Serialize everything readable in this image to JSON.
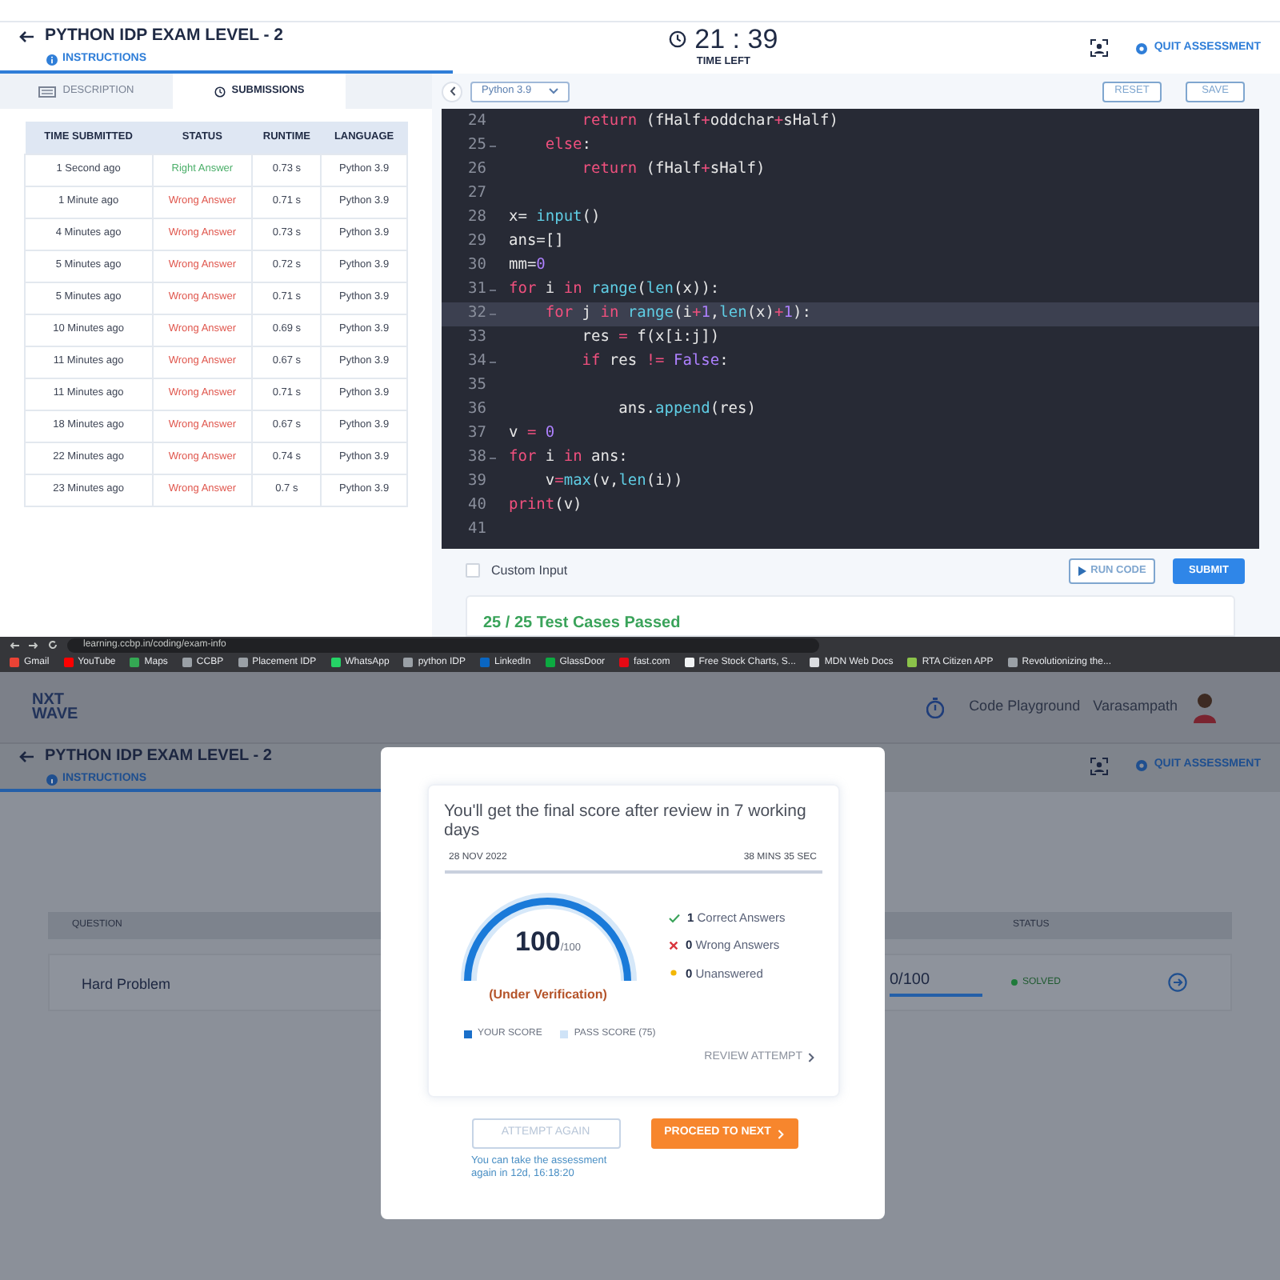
{
  "exam_top": {
    "title": "PYTHON IDP EXAM LEVEL - 2",
    "instructions": "INSTRUCTIONS",
    "timer": "21 : 39",
    "timer_label": "TIME LEFT",
    "quit": "QUIT ASSESSMENT"
  },
  "panel_tabs": [
    {
      "label": "DESCRIPTION",
      "selected": false
    },
    {
      "label": "SUBMISSIONS",
      "selected": true
    }
  ],
  "submissions": {
    "columns": [
      "TIME SUBMITTED",
      "STATUS",
      "RUNTIME",
      "LANGUAGE"
    ],
    "rows": [
      {
        "time": "1 Second ago",
        "status": "Right Answer",
        "correct": true,
        "runtime": "0.73 s",
        "language": "Python 3.9"
      },
      {
        "time": "1 Minute ago",
        "status": "Wrong Answer",
        "correct": false,
        "runtime": "0.71 s",
        "language": "Python 3.9"
      },
      {
        "time": "4 Minutes ago",
        "status": "Wrong Answer",
        "correct": false,
        "runtime": "0.73 s",
        "language": "Python 3.9"
      },
      {
        "time": "5 Minutes ago",
        "status": "Wrong Answer",
        "correct": false,
        "runtime": "0.72 s",
        "language": "Python 3.9"
      },
      {
        "time": "5 Minutes ago",
        "status": "Wrong Answer",
        "correct": false,
        "runtime": "0.71 s",
        "language": "Python 3.9"
      },
      {
        "time": "10 Minutes ago",
        "status": "Wrong Answer",
        "correct": false,
        "runtime": "0.69 s",
        "language": "Python 3.9"
      },
      {
        "time": "11 Minutes ago",
        "status": "Wrong Answer",
        "correct": false,
        "runtime": "0.67 s",
        "language": "Python 3.9"
      },
      {
        "time": "11 Minutes ago",
        "status": "Wrong Answer",
        "correct": false,
        "runtime": "0.71 s",
        "language": "Python 3.9"
      },
      {
        "time": "18 Minutes ago",
        "status": "Wrong Answer",
        "correct": false,
        "runtime": "0.67 s",
        "language": "Python 3.9"
      },
      {
        "time": "22 Minutes ago",
        "status": "Wrong Answer",
        "correct": false,
        "runtime": "0.74 s",
        "language": "Python 3.9"
      },
      {
        "time": "23 Minutes ago",
        "status": "Wrong Answer",
        "correct": false,
        "runtime": "0.7 s",
        "language": "Python 3.9"
      }
    ]
  },
  "editor": {
    "language": "Python 3.9",
    "reset": "RESET",
    "save": "SAVE",
    "lines": [
      {
        "number": "24",
        "fold": false,
        "active": false,
        "tokens": [
          {
            "t": "        return",
            "color": "#f0507e"
          },
          {
            "t": " (fHalf",
            "color": "#e6e6e6"
          },
          {
            "t": "+",
            "color": "#f0507f"
          },
          {
            "t": "oddchar",
            "color": "#e6e6e6"
          },
          {
            "t": "+",
            "color": "#f0507f"
          },
          {
            "t": "sHalf)",
            "color": "#e6e6e6"
          }
        ]
      },
      {
        "number": "25",
        "fold": true,
        "active": false,
        "tokens": [
          {
            "t": "    else",
            "color": "#f0507e"
          },
          {
            "t": ":",
            "color": "#e6e6e6"
          }
        ]
      },
      {
        "number": "26",
        "fold": false,
        "active": false,
        "tokens": [
          {
            "t": "        return",
            "color": "#f0507e"
          },
          {
            "t": " (fHalf",
            "color": "#e6e6e6"
          },
          {
            "t": "+",
            "color": "#f0507f"
          },
          {
            "t": "sHalf)",
            "color": "#e6e6e6"
          }
        ]
      },
      {
        "number": "27",
        "fold": false,
        "active": false
      },
      {
        "number": "28",
        "fold": false,
        "active": false,
        "tokens": [
          {
            "t": "x= ",
            "color": "#e6e6e6"
          },
          {
            "t": "input",
            "color": "#5fcde4"
          },
          {
            "t": "()",
            "color": "#e6e6e6"
          }
        ]
      },
      {
        "number": "29",
        "fold": false,
        "active": false,
        "tokens": [
          {
            "t": "ans=[]",
            "color": "#e6e6e6"
          }
        ]
      },
      {
        "number": "30",
        "fold": false,
        "active": false,
        "tokens": [
          {
            "t": "mm=",
            "color": "#e6e6e6"
          },
          {
            "t": "0",
            "color": "#ae81ff"
          }
        ]
      },
      {
        "number": "31",
        "fold": true,
        "active": false,
        "tokens": [
          {
            "t": "for",
            "color": "#f0507e"
          },
          {
            "t": " i ",
            "color": "#e6e6e6"
          },
          {
            "t": "in",
            "color": "#f0507e"
          },
          {
            "t": " range",
            "color": "#5fcde4"
          },
          {
            "t": "(",
            "color": "#e6e6e6"
          },
          {
            "t": "len",
            "color": "#5fcde4"
          },
          {
            "t": "(x)):",
            "color": "#e6e6e6"
          }
        ]
      },
      {
        "number": "32",
        "fold": true,
        "active": true,
        "tokens": [
          {
            "t": "    for",
            "color": "#f0507e"
          },
          {
            "t": " j ",
            "color": "#e6e6e6"
          },
          {
            "t": "in",
            "color": "#f0507e"
          },
          {
            "t": " range",
            "color": "#5fcde4"
          },
          {
            "t": "(i",
            "color": "#e6e6e6"
          },
          {
            "t": "+",
            "color": "#f0507f"
          },
          {
            "t": "1",
            "color": "#ae81ff"
          },
          {
            "t": ",",
            "color": "#e6e6e6"
          },
          {
            "t": "len",
            "color": "#5fcde4"
          },
          {
            "t": "(x)",
            "color": "#e6e6e6"
          },
          {
            "t": "+",
            "color": "#f0507f"
          },
          {
            "t": "1",
            "color": "#ae81ff"
          },
          {
            "t": "):",
            "color": "#e6e6e6"
          }
        ]
      },
      {
        "number": "33",
        "fold": false,
        "active": false,
        "tokens": [
          {
            "t": "        res ",
            "color": "#e6e6e6"
          },
          {
            "t": "=",
            "color": "#f0507f"
          },
          {
            "t": " f(x[i:j])",
            "color": "#e6e6e6"
          }
        ]
      },
      {
        "number": "34",
        "fold": true,
        "active": false,
        "tokens": [
          {
            "t": "        if",
            "color": "#f0507e"
          },
          {
            "t": " res ",
            "color": "#e6e6e6"
          },
          {
            "t": "!=",
            "color": "#f0507f"
          },
          {
            "t": " False",
            "color": "#ae81ff"
          },
          {
            "t": ":",
            "color": "#e6e6e6"
          }
        ]
      },
      {
        "number": "35",
        "fold": false,
        "active": false
      },
      {
        "number": "36",
        "fold": false,
        "active": false,
        "tokens": [
          {
            "t": "            ans.",
            "color": "#e6e6e6"
          },
          {
            "t": "append",
            "color": "#5fcde4"
          },
          {
            "t": "(res)",
            "color": "#e6e6e6"
          }
        ]
      },
      {
        "number": "37",
        "fold": false,
        "active": false,
        "tokens": [
          {
            "t": "v ",
            "color": "#e6e6e6"
          },
          {
            "t": "=",
            "color": "#f0507f"
          },
          {
            "t": " 0",
            "color": "#ae81ff"
          }
        ]
      },
      {
        "number": "38",
        "fold": true,
        "active": false,
        "tokens": [
          {
            "t": "for",
            "color": "#f0507e"
          },
          {
            "t": " i ",
            "color": "#e6e6e6"
          },
          {
            "t": "in",
            "color": "#f0507e"
          },
          {
            "t": " ans:",
            "color": "#e6e6e6"
          }
        ]
      },
      {
        "number": "39",
        "fold": false,
        "active": false,
        "tokens": [
          {
            "t": "    v",
            "color": "#e6e6e6"
          },
          {
            "t": "=",
            "color": "#f0507f"
          },
          {
            "t": "max",
            "color": "#5fcde4"
          },
          {
            "t": "(v,",
            "color": "#e6e6e6"
          },
          {
            "t": "len",
            "color": "#5fcde4"
          },
          {
            "t": "(i))",
            "color": "#e6e6e6"
          }
        ]
      },
      {
        "number": "40",
        "fold": false,
        "active": false,
        "tokens": [
          {
            "t": "print",
            "color": "#f0507e"
          },
          {
            "t": "(v)",
            "color": "#e6e6e6"
          }
        ]
      },
      {
        "number": "41",
        "fold": false,
        "active": false
      }
    ],
    "custom_input": {
      "label": "Custom Input",
      "checked": false
    },
    "run": "RUN CODE",
    "submit": "SUBMIT",
    "result": "25 / 25 Test Cases Passed"
  },
  "browser": {
    "url": "learning.ccbp.in/coding/exam-info",
    "bookmarks": [
      {
        "label": "Gmail",
        "color": "#ea4335"
      },
      {
        "label": "YouTube",
        "color": "#ff0000"
      },
      {
        "label": "Maps",
        "color": "#34a853"
      },
      {
        "label": "CCBP",
        "color": "#9aa0a6"
      },
      {
        "label": "Placement IDP",
        "color": "#9aa0a6"
      },
      {
        "label": "WhatsApp",
        "color": "#25d366"
      },
      {
        "label": "python IDP",
        "color": "#9aa0a6"
      },
      {
        "label": "LinkedIn",
        "color": "#0a66c2"
      },
      {
        "label": "GlassDoor",
        "color": "#0caa41"
      },
      {
        "label": "fast.com",
        "color": "#e50914"
      },
      {
        "label": "Free Stock Charts, S...",
        "color": "#f1f3f4"
      },
      {
        "label": "MDN Web Docs",
        "color": "#dadce0"
      },
      {
        "label": "RTA Citizen APP",
        "color": "#8bc34a"
      },
      {
        "label": "Revolutionizing the...",
        "color": "#9aa0a6"
      }
    ]
  },
  "app_header": {
    "logo_top": "NXT",
    "logo_bottom": "WAVE",
    "playground": "Code Playground",
    "user": "Varasampath"
  },
  "exam_bottom": {
    "title": "PYTHON IDP EXAM LEVEL - 2",
    "instructions": "INSTRUCTIONS",
    "quit": "QUIT ASSESSMENT"
  },
  "questions": {
    "columns": [
      "QUESTION",
      "STATUS"
    ],
    "rows": [
      {
        "question": "Hard Problem",
        "score": "0/100",
        "status": "SOLVED"
      }
    ]
  },
  "result_modal": {
    "message": "You'll get the final score after review in 7 working days",
    "date": "28 NOV 2022",
    "duration": "38 MINS 35 SEC",
    "score": "100",
    "score_total": "/100",
    "level": 1,
    "verification": "(Under Verification)",
    "stats": [
      {
        "kind": "correct",
        "count": "1",
        "label": "Correct Answers"
      },
      {
        "kind": "wrong",
        "count": "0",
        "label": "Wrong Answers"
      },
      {
        "kind": "unanswered",
        "count": "0",
        "label": "Unanswered"
      }
    ],
    "legend": [
      {
        "label": "YOUR SCORE",
        "color": "#1a6fc9"
      },
      {
        "label": "PASS SCORE (75)",
        "color": "#cfe3f7"
      }
    ],
    "review": "REVIEW ATTEMPT",
    "attempt_again": "ATTEMPT AGAIN",
    "proceed": "PROCEED TO NEXT",
    "note": "You can take the assessment again in 12d, 16:18:20"
  }
}
